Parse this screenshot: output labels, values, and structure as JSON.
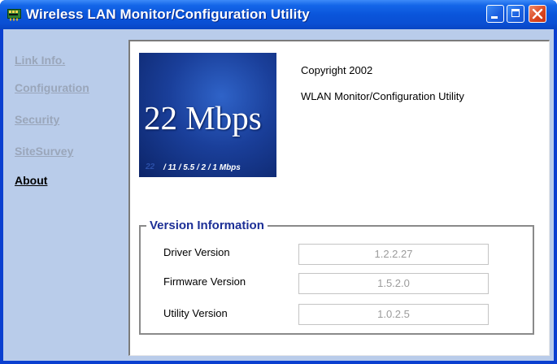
{
  "window": {
    "title": "Wireless LAN Monitor/Configuration Utility",
    "icon": "network-card-icon",
    "controls": [
      "minimize-icon",
      "maximize-icon",
      "close-icon"
    ]
  },
  "sidebar": {
    "items": [
      {
        "label": "Link Info.",
        "active": false
      },
      {
        "label": "Configuration",
        "active": false
      },
      {
        "label": "Security",
        "active": false
      },
      {
        "label": "SiteSurvey",
        "active": false
      },
      {
        "label": "About",
        "active": true
      }
    ]
  },
  "about": {
    "logo": {
      "headline": "22 Mbps",
      "subline": "/ 11 / 5.5 / 2 / 1 Mbps",
      "ghost": "22"
    },
    "copyright": "Copyright 2002",
    "product_name": "WLAN Monitor/Configuration Utility"
  },
  "version_info": {
    "title": "Version Information",
    "rows": [
      {
        "label": "Driver Version",
        "value": "1.2.2.27"
      },
      {
        "label": "Firmware Version",
        "value": "1.5.2.0"
      },
      {
        "label": "Utility Version",
        "value": "1.0.2.5"
      }
    ]
  },
  "colors": {
    "titlebar": "#0a55db",
    "sidebar_bg": "#b9ccea",
    "group_title": "#1c2f96",
    "close_button": "#d9451d"
  }
}
